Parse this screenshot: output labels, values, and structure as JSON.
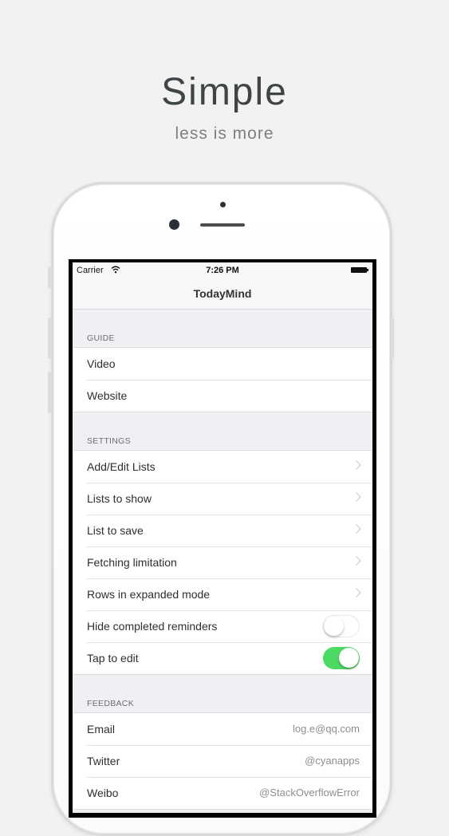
{
  "hero": {
    "title": "Simple",
    "subtitle": "less is more"
  },
  "status_bar": {
    "carrier": "Carrier",
    "time": "7:26 PM"
  },
  "nav": {
    "title": "TodayMind"
  },
  "sections": {
    "guide": {
      "header": "GUIDE",
      "items": [
        "Video",
        "Website"
      ]
    },
    "settings": {
      "header": "SETTINGS",
      "items": [
        "Add/Edit Lists",
        "Lists to show",
        "List to save",
        "Fetching limitation",
        "Rows in expanded mode"
      ],
      "toggles": [
        {
          "label": "Hide completed reminders",
          "on": false
        },
        {
          "label": "Tap to edit",
          "on": true
        }
      ]
    },
    "feedback": {
      "header": "FEEDBACK",
      "items": [
        {
          "label": "Email",
          "value": "log.e@qq.com"
        },
        {
          "label": "Twitter",
          "value": "@cyanapps"
        },
        {
          "label": "Weibo",
          "value": "@StackOverflowError"
        }
      ]
    }
  },
  "colors": {
    "toggle_on": "#4cd964",
    "background": "#f2f2f3"
  }
}
